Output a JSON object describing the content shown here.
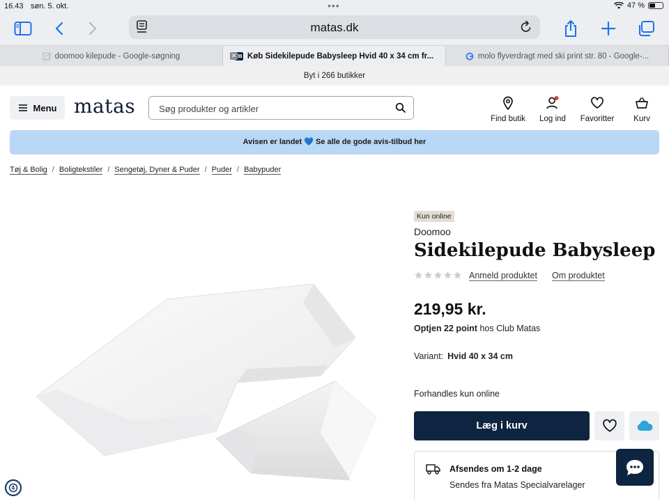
{
  "status": {
    "time": "16.43",
    "date": "søn. 5. okt.",
    "battery": "47 %",
    "battery_level": 0.47
  },
  "browser": {
    "url": "matas.dk",
    "tabs": [
      {
        "label": "doomoo kilepude - Google-søgning",
        "favicon": "google-icon"
      },
      {
        "label": "Køb Sidekilepude Babysleep Hvid 40 x 34 cm fr...",
        "favicon": "matas-icon",
        "active": true
      },
      {
        "label": "molo flyverdragt med ski print str. 80 - Google-...",
        "favicon": "google-icon"
      }
    ]
  },
  "banner": {
    "text": "Byt i 266 butikker"
  },
  "header": {
    "menu_label": "Menu",
    "logo": "matas",
    "search_placeholder": "Søg produkter og artikler",
    "actions": [
      {
        "label": "Find butik",
        "icon": "location-pin-icon"
      },
      {
        "label": "Log ind",
        "icon": "user-icon"
      },
      {
        "label": "Favoritter",
        "icon": "heart-icon"
      },
      {
        "label": "Kurv",
        "icon": "basket-icon"
      }
    ]
  },
  "promo": {
    "text": "Avisen er landet 💙 Se alle de gode avis-tilbud her"
  },
  "breadcrumb": [
    "Tøj & Bolig",
    "Boligtekstiler",
    "Sengetøj, Dyner & Puder",
    "Puder",
    "Babypuder"
  ],
  "product": {
    "badge": "Kun online",
    "brand": "Doomoo",
    "title": "Sidekilepude Babysleep",
    "rating": 0,
    "rating_max": 5,
    "review_link": "Anmeld produktet",
    "about_link": "Om produktet",
    "price": "219,95 kr.",
    "points_bold": "Optjen 22 point",
    "points_rest": " hos Club Matas",
    "variant_label": "Variant:",
    "variant_value": "Hvid 40 x 34 cm",
    "online_text": "Forhandles kun online",
    "add_to_cart": "Læg i kurv",
    "shipping_title": "Afsendes om 1-2 dage",
    "shipping_sub": "Sendes fra Matas Specialvarelager"
  },
  "colors": {
    "navy": "#0d2540",
    "promo_bg": "#b8d8f6",
    "badge_bg": "#e3ddd3",
    "cloud": "#2aa6d8"
  }
}
